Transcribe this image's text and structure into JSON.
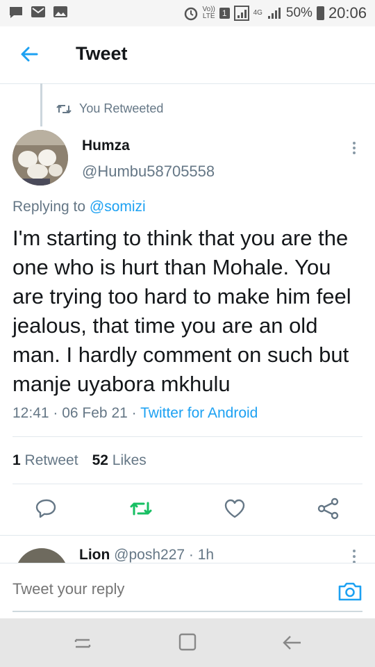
{
  "status_bar": {
    "volte_line1": "Vo))",
    "volte_line2": "LTE",
    "sim_badge": "1",
    "network": "4G",
    "battery_percent": "50%",
    "time": "20:06"
  },
  "header": {
    "title": "Tweet",
    "back_icon": "arrow-left-icon"
  },
  "retweet_banner": {
    "text": "You Retweeted",
    "icon": "retweet-icon"
  },
  "tweet": {
    "author_name": "Humza",
    "author_handle": "@Humbu58705558",
    "replying_prefix": "Replying to ",
    "replying_handle": "@somizi",
    "text": "I'm starting to think that you are the one who is hurt than Mohale. You are trying too hard to make him feel jealous, that time you are an old man. I hardly comment on such but manje uyabora mkhulu",
    "time": "12:41",
    "sep1": " · ",
    "date": "06 Feb 21",
    "sep2": " · ",
    "source": "Twitter for Android",
    "retweet_count": "1",
    "retweet_label": "Retweet",
    "like_count": "52",
    "like_label": "Likes"
  },
  "actions": {
    "reply_icon": "reply-icon",
    "retweet_icon": "retweet-icon",
    "like_icon": "heart-icon",
    "share_icon": "share-icon",
    "retweeted_color": "#17bf63"
  },
  "next_reply": {
    "name": "Lion",
    "handle_time": "@posh227 · 1h"
  },
  "reply_bar": {
    "placeholder": "Tweet your reply"
  },
  "colors": {
    "accent": "#1da1f2",
    "secondary_text": "#657786",
    "primary_text": "#14171a"
  }
}
